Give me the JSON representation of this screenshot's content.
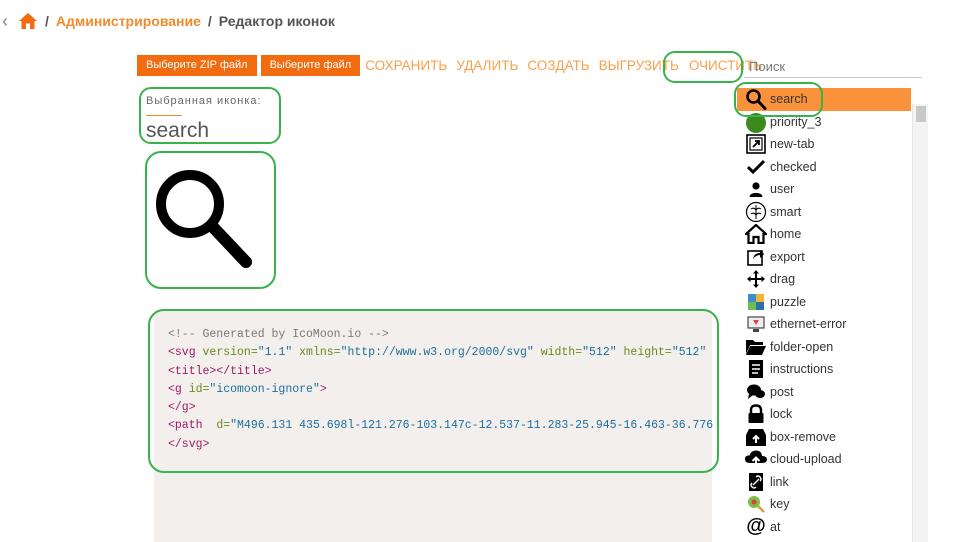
{
  "breadcrumb": {
    "back_icon": "chevron-left-icon",
    "home_icon": "home-icon",
    "separator": "/",
    "admin": "Администрирование",
    "current": "Редактор иконок"
  },
  "toolbar": {
    "zip_button": "Выберите ZIP файл",
    "file_button": "Выберите файл",
    "save": "СОХРАНИТЬ",
    "delete": "УДАЛИТЬ",
    "create": "СОЗДАТЬ",
    "export": "ВЫГРУЗИТЬ",
    "clear": "ОЧИСТИТЬ",
    "search_placeholder": "Поиск"
  },
  "selected": {
    "label": "Выбранная иконка:",
    "name": "search"
  },
  "code": {
    "comment": "<!-- Generated by IcoMoon.io -->",
    "svg_open": "<svg",
    "version_attr": " version=",
    "version_val": "\"1.1\"",
    "xmlns_attr": " xmlns=",
    "xmlns_val": "\"http://www.w3.org/2000/svg\"",
    "width_attr": " width=",
    "width_val": "\"512\"",
    "height_attr": " height=",
    "height_val": "\"512\"",
    "title": "<title></title>",
    "g_open": "<g",
    "g_id_attr": " id=",
    "g_id_val": "\"icomoon-ignore\"",
    "gt": ">",
    "g_close": "</g>",
    "path_open": "<path",
    "path_d_attr": "  d=",
    "path_d_val": "\"M496.131 435.698l-121.276-103.147c-12.537-11.283-25.945-16.463-36.776",
    "svg_close": "</svg>"
  },
  "icons": [
    {
      "name": "search",
      "icon": "search-icon",
      "active": true
    },
    {
      "name": "priority_3",
      "icon": "priority-icon"
    },
    {
      "name": "new-tab",
      "icon": "new-tab-icon"
    },
    {
      "name": "checked",
      "icon": "checkmark-icon"
    },
    {
      "name": "user",
      "icon": "user-icon"
    },
    {
      "name": "smart",
      "icon": "brain-icon"
    },
    {
      "name": "home",
      "icon": "home-icon"
    },
    {
      "name": "export",
      "icon": "export-icon"
    },
    {
      "name": "drag",
      "icon": "drag-icon"
    },
    {
      "name": "puzzle",
      "icon": "puzzle-icon"
    },
    {
      "name": "ethernet-error",
      "icon": "ethernet-error-icon"
    },
    {
      "name": "folder-open",
      "icon": "folder-open-icon"
    },
    {
      "name": "instructions",
      "icon": "instructions-icon"
    },
    {
      "name": "post",
      "icon": "post-icon"
    },
    {
      "name": "lock",
      "icon": "lock-icon"
    },
    {
      "name": "box-remove",
      "icon": "box-remove-icon"
    },
    {
      "name": "cloud-upload",
      "icon": "cloud-upload-icon"
    },
    {
      "name": "link",
      "icon": "link-icon"
    },
    {
      "name": "key",
      "icon": "key-icon"
    },
    {
      "name": "at",
      "icon": "at-icon"
    }
  ],
  "colors": {
    "accent": "#f26b0f",
    "accent_light": "#f8a04c",
    "active_row": "#fa913b",
    "highlight": "#38b24a"
  }
}
